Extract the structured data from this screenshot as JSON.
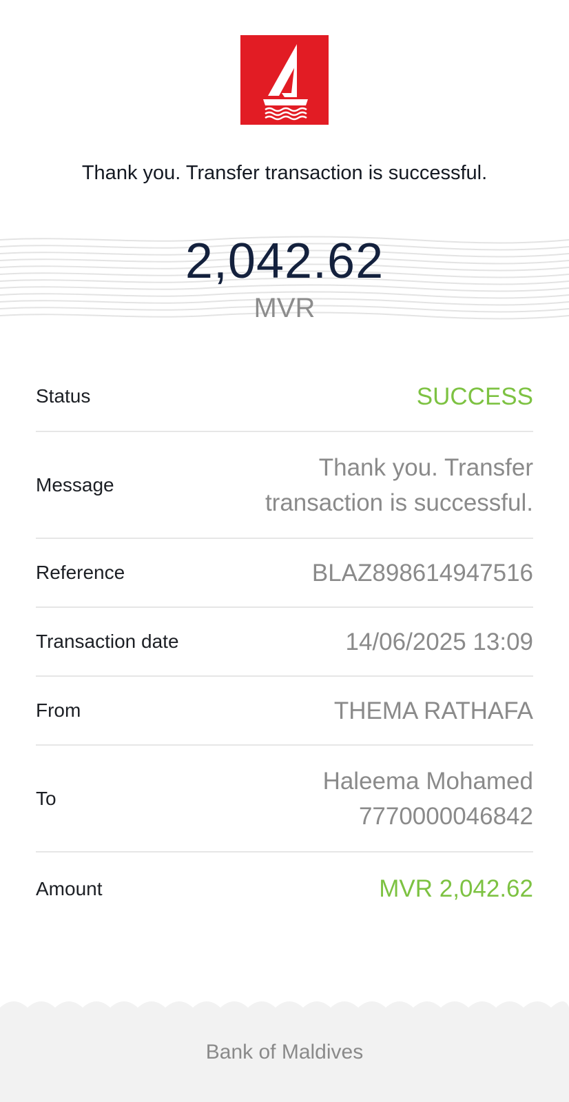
{
  "logo": {
    "icon": "sailboat-logo-icon",
    "background": "#e21c24"
  },
  "headline": "Thank you. Transfer transaction is successful.",
  "amount": {
    "value": "2,042.62",
    "currency": "MVR"
  },
  "details": [
    {
      "label": "Status",
      "value": "SUCCESS",
      "accent": "#7dc242"
    },
    {
      "label": "Message",
      "value": "Thank you. Transfer transaction is successful."
    },
    {
      "label": "Reference",
      "value": "BLAZ898614947516"
    },
    {
      "label": "Transaction date",
      "value": "14/06/2025 13:09"
    },
    {
      "label": "From",
      "value": "THEMA RATHAFA"
    },
    {
      "label": "To",
      "value_line1": "Haleema Mohamed",
      "value_line2": "7770000046842"
    },
    {
      "label": "Amount",
      "value": "MVR 2,042.62",
      "accent": "#7dc242"
    }
  ],
  "footer": {
    "text": "Bank of Maldives"
  },
  "colors": {
    "brand_red": "#e21c24",
    "amount_navy": "#14213d",
    "success_green": "#7dc242",
    "muted_gray": "#8a8a8a"
  }
}
